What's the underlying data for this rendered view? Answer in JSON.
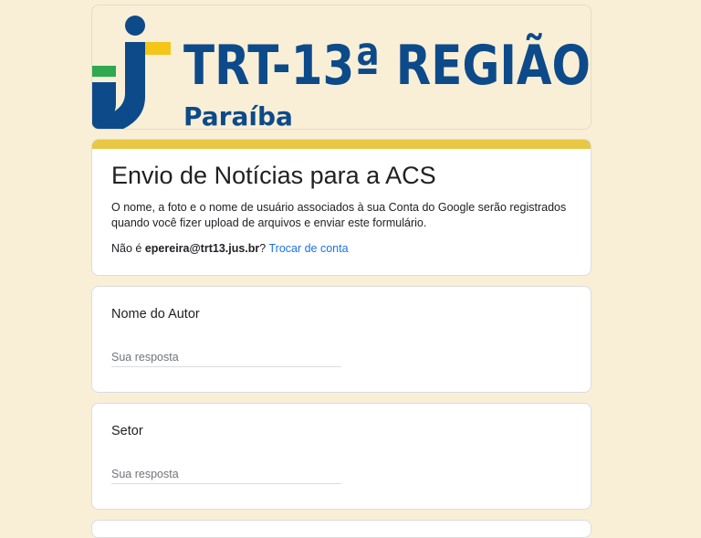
{
  "banner": {
    "org_name": "TRT-13ª REGIÃO",
    "region": "Paraíba",
    "colors": {
      "blue": "#0d4a8a",
      "green": "#2fa84f",
      "yellow": "#f5c518"
    }
  },
  "form": {
    "title": "Envio de Notícias para a ACS",
    "description": "O nome, a foto e o nome de usuário associados à sua Conta do Google serão registrados quando você fizer upload de arquivos e enviar este formulário.",
    "account_prefix": "Não é ",
    "account_email": "epereira@trt13.jus.br",
    "account_suffix": "? ",
    "switch_account": "Trocar de conta",
    "accent_color": "#e8c744"
  },
  "questions": [
    {
      "label": "Nome do Autor",
      "placeholder": "Sua resposta",
      "value": ""
    },
    {
      "label": "Setor",
      "placeholder": "Sua resposta",
      "value": ""
    }
  ]
}
